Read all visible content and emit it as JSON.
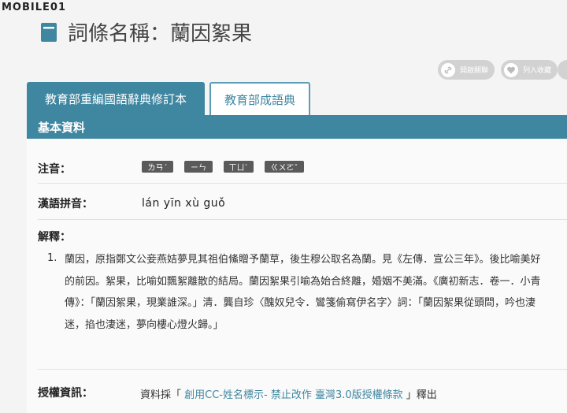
{
  "watermark": "MOBILE01",
  "page_title": "詞條名稱：蘭因絮果",
  "actions": {
    "share_label": "開啟關聯",
    "favorite_label": "列入收藏"
  },
  "tabs": [
    {
      "label": "教育部重編國語辭典修訂本",
      "active": true
    },
    {
      "label": "教育部成語典",
      "active": false
    }
  ],
  "section_title": "基本資料",
  "fields": {
    "zhuyin_label": "注音：",
    "zhuyin": [
      "ㄌㄢˊ",
      "ㄧㄣ",
      "ㄒㄩˋ",
      "ㄍㄨㄛˇ"
    ],
    "pinyin_label": "漢語拼音：",
    "pinyin": "lán yīn xù guǒ",
    "definition_label": "解釋：",
    "definitions": [
      {
        "number": "1.",
        "text": "蘭因，原指鄭文公妾燕姞夢見其祖伯鯈贈予蘭草，後生穆公取名為蘭。見《左傳．宣公三年》。後比喻美好的前因。絮果，比喻如飄絮離散的結局。蘭因絮果引喻為始合終離，婚姻不美滿。《廣初新志．卷一．小青傳》：「蘭因絮果，現業誰深。」清．龔自珍〈醜奴兒令．鸞箋偷寫伊名字〉詞：「蘭因絮果從頭問，吟也淒迷，掐也淒迷，夢向樓心燈火歸。」"
      }
    ],
    "license_label": "授權資訊：",
    "license_prefix": "資料採「",
    "license_link": "創用CC-姓名標示- 禁止改作 臺灣3.0版授權條款",
    "license_suffix": "」釋出"
  },
  "colors": {
    "accent": "#3f86a0",
    "tag_bg": "#5a5a5a",
    "button_bg": "#d2d2d2"
  },
  "icons": {
    "title": "book-icon",
    "share": "link-icon",
    "favorite": "heart-icon"
  }
}
